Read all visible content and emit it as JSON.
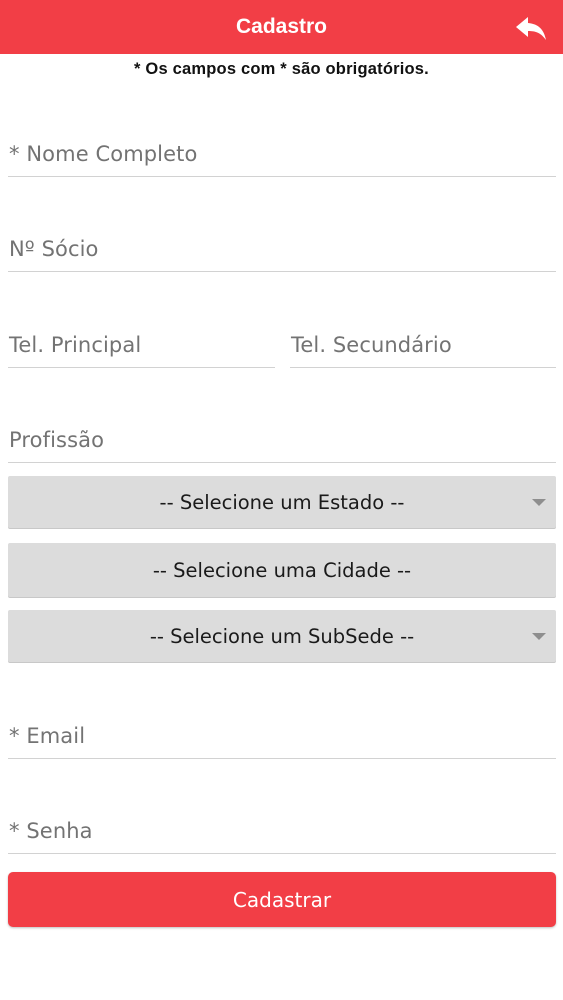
{
  "header": {
    "title": "Cadastro",
    "back_icon": "reply-back-icon",
    "color": "#f23e46"
  },
  "note": "* Os campos com * são obrigatórios.",
  "fields": {
    "name": "* Nome Completo",
    "member_no": "Nº Sócio",
    "phone_main": "Tel. Principal",
    "phone_secondary": "Tel. Secundário",
    "profession": "Profissão",
    "email": "* Email",
    "password": "* Senha"
  },
  "selects": {
    "state": "-- Selecione um Estado --",
    "city": "-- Selecione uma Cidade --",
    "subsede": "-- Selecione um SubSede --"
  },
  "submit_label": "Cadastrar"
}
